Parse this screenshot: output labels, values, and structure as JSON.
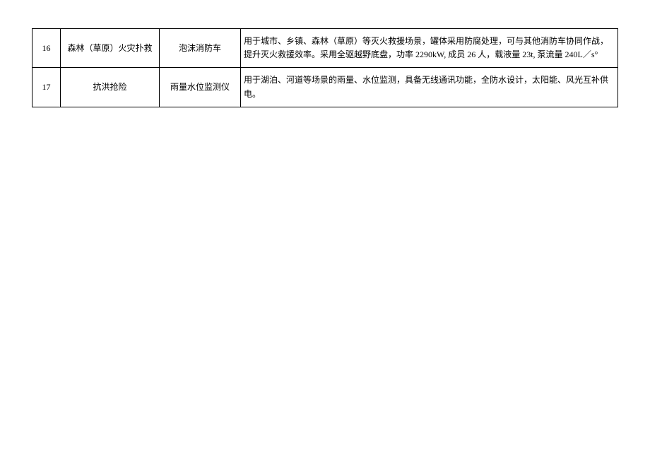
{
  "table": {
    "rows": [
      {
        "num": "16",
        "category": "森林（草原）火灾扑救",
        "name": "泡沫消防车",
        "desc": "用于城市、乡镇、森林（草原）等灭火救援场景，罐体采用防腐处理，可与其他消防车协同作战，提升灭火救援效率。采用全驱越野底盘，功率 2290kW, 成员 26 人，载液量 23t, 泵流量 240L／s°"
      },
      {
        "num": "17",
        "category": "抗洪抢险",
        "name": "雨量水位监测仪",
        "desc": "用于湖泊、河道等场景的雨量、水位监测，具备无线通讯功能，全防水设计，太阳能、风光互补供电。"
      }
    ]
  }
}
